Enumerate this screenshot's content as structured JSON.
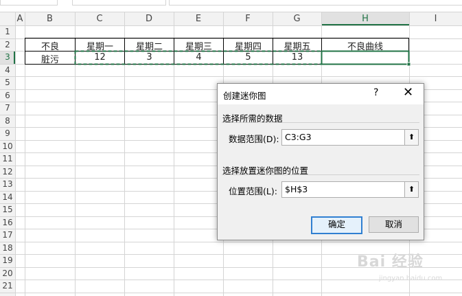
{
  "columns": [
    "A",
    "B",
    "C",
    "D",
    "E",
    "F",
    "G",
    "H",
    "I"
  ],
  "rows": [
    "1",
    "2",
    "3",
    "4",
    "5",
    "6",
    "7",
    "8",
    "9",
    "10",
    "11",
    "12",
    "13",
    "14",
    "15",
    "16",
    "17",
    "18",
    "19",
    "20",
    "21"
  ],
  "table": {
    "header": [
      "不良",
      "星期一",
      "星期二",
      "星期三",
      "星期四",
      "星期五",
      "不良曲线"
    ],
    "row": [
      "脏污",
      "12",
      "3",
      "4",
      "5",
      "13",
      ""
    ]
  },
  "dialog": {
    "title": "创建迷你图",
    "help": "?",
    "close": "✕",
    "section1": "选择所需的数据",
    "data_range_label": "数据范围(D):",
    "data_range_value": "C3:G3",
    "section2": "选择放置迷你图的位置",
    "location_label": "位置范围(L):",
    "location_value": "$H$3",
    "collapse_icon": "⬆",
    "ok": "确定",
    "cancel": "取消"
  },
  "colors": {
    "accent": "#217346",
    "arrow": "#e8413b",
    "dialog_primary": "#2f7fd1"
  },
  "watermark": {
    "text": "Bai 经验",
    "sub": "jingyan.baidu.com"
  }
}
